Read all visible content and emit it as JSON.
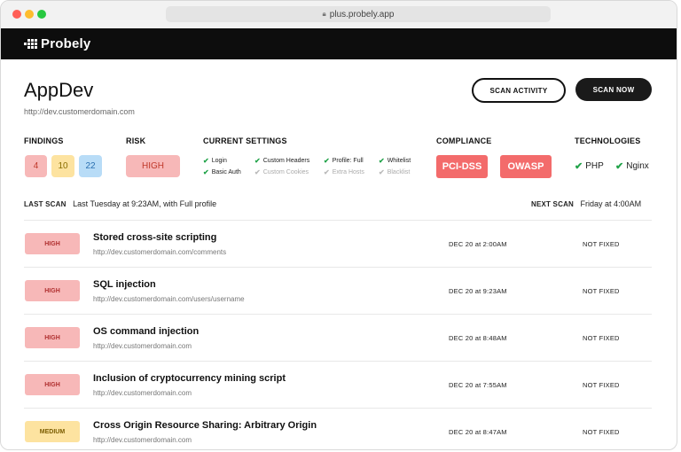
{
  "browser": {
    "url": "plus.probely.app"
  },
  "app": {
    "brand": "Probely"
  },
  "target": {
    "name": "AppDev",
    "url": "http://dev.customerdomain.com",
    "scan_activity_label": "SCAN ACTIVITY",
    "scan_now_label": "SCAN NOW"
  },
  "findings": {
    "label": "FINDINGS",
    "high": "4",
    "medium": "10",
    "low": "22"
  },
  "risk": {
    "label": "RISK",
    "value": "HIGH"
  },
  "settings": {
    "label": "CURRENT SETTINGS",
    "items": [
      {
        "label": "Login",
        "enabled": true
      },
      {
        "label": "Basic Auth",
        "enabled": true
      },
      {
        "label": "Custom Headers",
        "enabled": true
      },
      {
        "label": "Custom Cookies",
        "enabled": false
      },
      {
        "label": "Profile: Full",
        "enabled": true
      },
      {
        "label": "Extra Hosts",
        "enabled": false
      },
      {
        "label": "Whitelist",
        "enabled": true
      },
      {
        "label": "Blacklist",
        "enabled": false
      }
    ]
  },
  "compliance": {
    "label": "COMPLIANCE",
    "items": [
      "PCI-DSS",
      "OWASP"
    ]
  },
  "technologies": {
    "label": "TECHNOLOGIES",
    "items": [
      "PHP",
      "Nginx"
    ]
  },
  "scan": {
    "last_label": "LAST SCAN",
    "last_value": "Last Tuesday at 9:23AM, with Full profile",
    "next_label": "NEXT SCAN",
    "next_value": "Friday at 4:00AM"
  },
  "vulnerabilities": [
    {
      "severity": "HIGH",
      "title": "Stored cross-site scripting",
      "url": "http://dev.customerdomain.com/comments",
      "date": "DEC 20 at 2:00AM",
      "status": "NOT FIXED"
    },
    {
      "severity": "HIGH",
      "title": "SQL injection",
      "url": "http://dev.customerdomain.com/users/username",
      "date": "DEC 20 at 9:23AM",
      "status": "NOT FIXED"
    },
    {
      "severity": "HIGH",
      "title": "OS command injection",
      "url": "http://dev.customerdomain.com",
      "date": "DEC 20 at 8:48AM",
      "status": "NOT FIXED"
    },
    {
      "severity": "HIGH",
      "title": "Inclusion of cryptocurrency mining script",
      "url": "http://dev.customerdomain.com",
      "date": "DEC 20 at 7:55AM",
      "status": "NOT FIXED"
    },
    {
      "severity": "MEDIUM",
      "title": "Cross Origin Resource Sharing: Arbitrary Origin",
      "url": "http://dev.customerdomain.com",
      "date": "DEC 20 at 8:47AM",
      "status": "NOT FIXED"
    }
  ],
  "colors": {
    "high_bg": "#f7b8b8",
    "medium_bg": "#fde3a0",
    "low_bg": "#b8dcf7",
    "compliance": "#f36b6b",
    "check": "#22a34a"
  }
}
